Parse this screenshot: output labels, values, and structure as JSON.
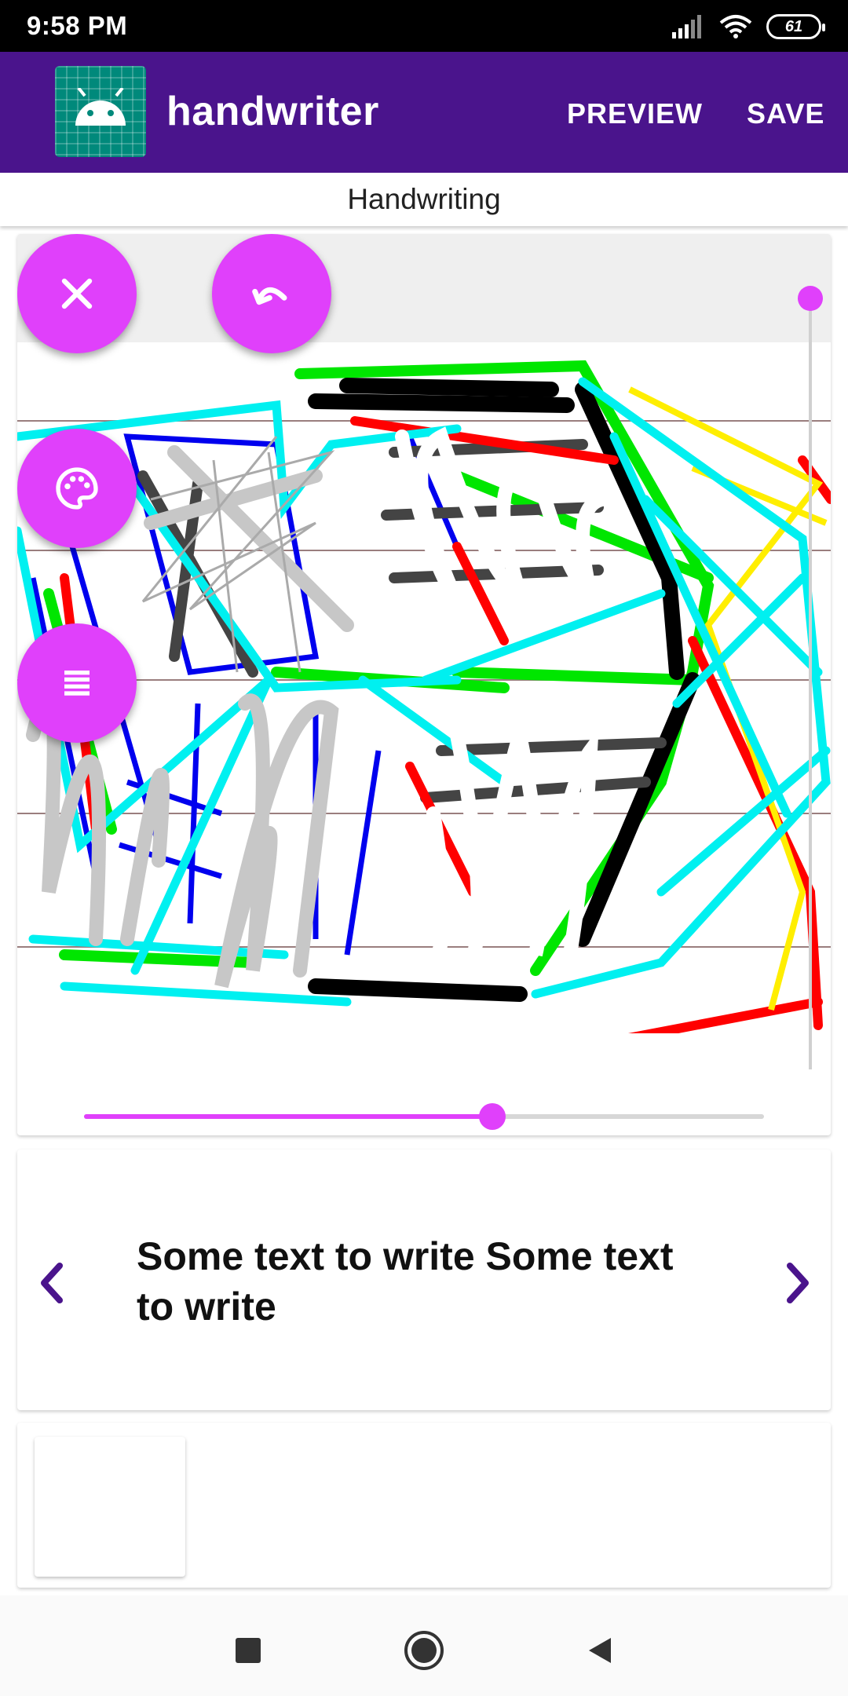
{
  "status_bar": {
    "time": "9:58 PM",
    "battery": "61",
    "icons": [
      "signal-icon",
      "wifi-icon",
      "battery-icon"
    ]
  },
  "app_bar": {
    "title": "handwriter",
    "actions": {
      "preview": "PREVIEW",
      "save": "SAVE"
    },
    "color": "#4a148c"
  },
  "section": {
    "title": "Handwriting"
  },
  "canvas": {
    "fab_icons": [
      "close-icon",
      "undo-icon",
      "palette-icon",
      "menu-icon"
    ],
    "accent_color": "#e040fb",
    "horizontal_slider_value": 0.6
  },
  "text_panel": {
    "text": "Some text to write Some text to write",
    "prev_icon": "chevron-left-icon",
    "next_icon": "chevron-right-icon"
  },
  "nav_bar": {
    "icons": [
      "recents-square-icon",
      "home-circle-icon",
      "back-triangle-icon"
    ]
  }
}
